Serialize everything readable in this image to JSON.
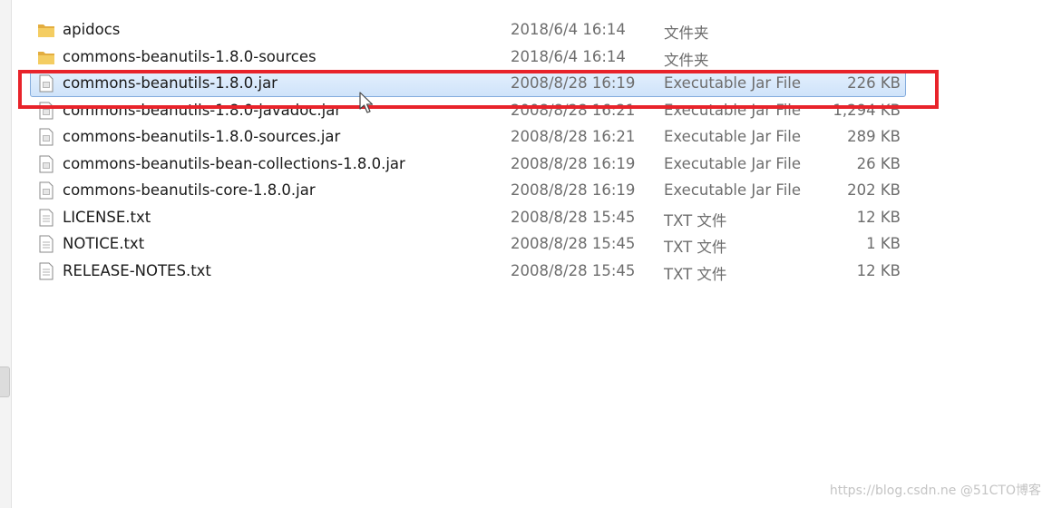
{
  "files": [
    {
      "name": "apidocs",
      "date": "2018/6/4 16:14",
      "type": "文件夹",
      "size": "",
      "icon": "folder-icon"
    },
    {
      "name": "commons-beanutils-1.8.0-sources",
      "date": "2018/6/4 16:14",
      "type": "文件夹",
      "size": "",
      "icon": "folder-icon"
    },
    {
      "name": "commons-beanutils-1.8.0.jar",
      "date": "2008/8/28 16:19",
      "type": "Executable Jar File",
      "size": "226 KB",
      "icon": "jar-file-icon",
      "selected": true
    },
    {
      "name": "commons-beanutils-1.8.0-javadoc.jar",
      "date": "2008/8/28 16:21",
      "type": "Executable Jar File",
      "size": "1,294 KB",
      "icon": "jar-file-icon"
    },
    {
      "name": "commons-beanutils-1.8.0-sources.jar",
      "date": "2008/8/28 16:21",
      "type": "Executable Jar File",
      "size": "289 KB",
      "icon": "jar-file-icon"
    },
    {
      "name": "commons-beanutils-bean-collections-1.8.0.jar",
      "date": "2008/8/28 16:19",
      "type": "Executable Jar File",
      "size": "26 KB",
      "icon": "jar-file-icon"
    },
    {
      "name": "commons-beanutils-core-1.8.0.jar",
      "date": "2008/8/28 16:19",
      "type": "Executable Jar File",
      "size": "202 KB",
      "icon": "jar-file-icon"
    },
    {
      "name": "LICENSE.txt",
      "date": "2008/8/28 15:45",
      "type": "TXT 文件",
      "size": "12 KB",
      "icon": "text-file-icon"
    },
    {
      "name": "NOTICE.txt",
      "date": "2008/8/28 15:45",
      "type": "TXT 文件",
      "size": "1 KB",
      "icon": "text-file-icon"
    },
    {
      "name": "RELEASE-NOTES.txt",
      "date": "2008/8/28 15:45",
      "type": "TXT 文件",
      "size": "12 KB",
      "icon": "text-file-icon"
    }
  ],
  "watermark": "https://blog.csdn.ne @51CTO博客",
  "colors": {
    "annotation_box": "#e8232a",
    "selection": "#cfe3fa",
    "folder": "#e8b64a"
  }
}
